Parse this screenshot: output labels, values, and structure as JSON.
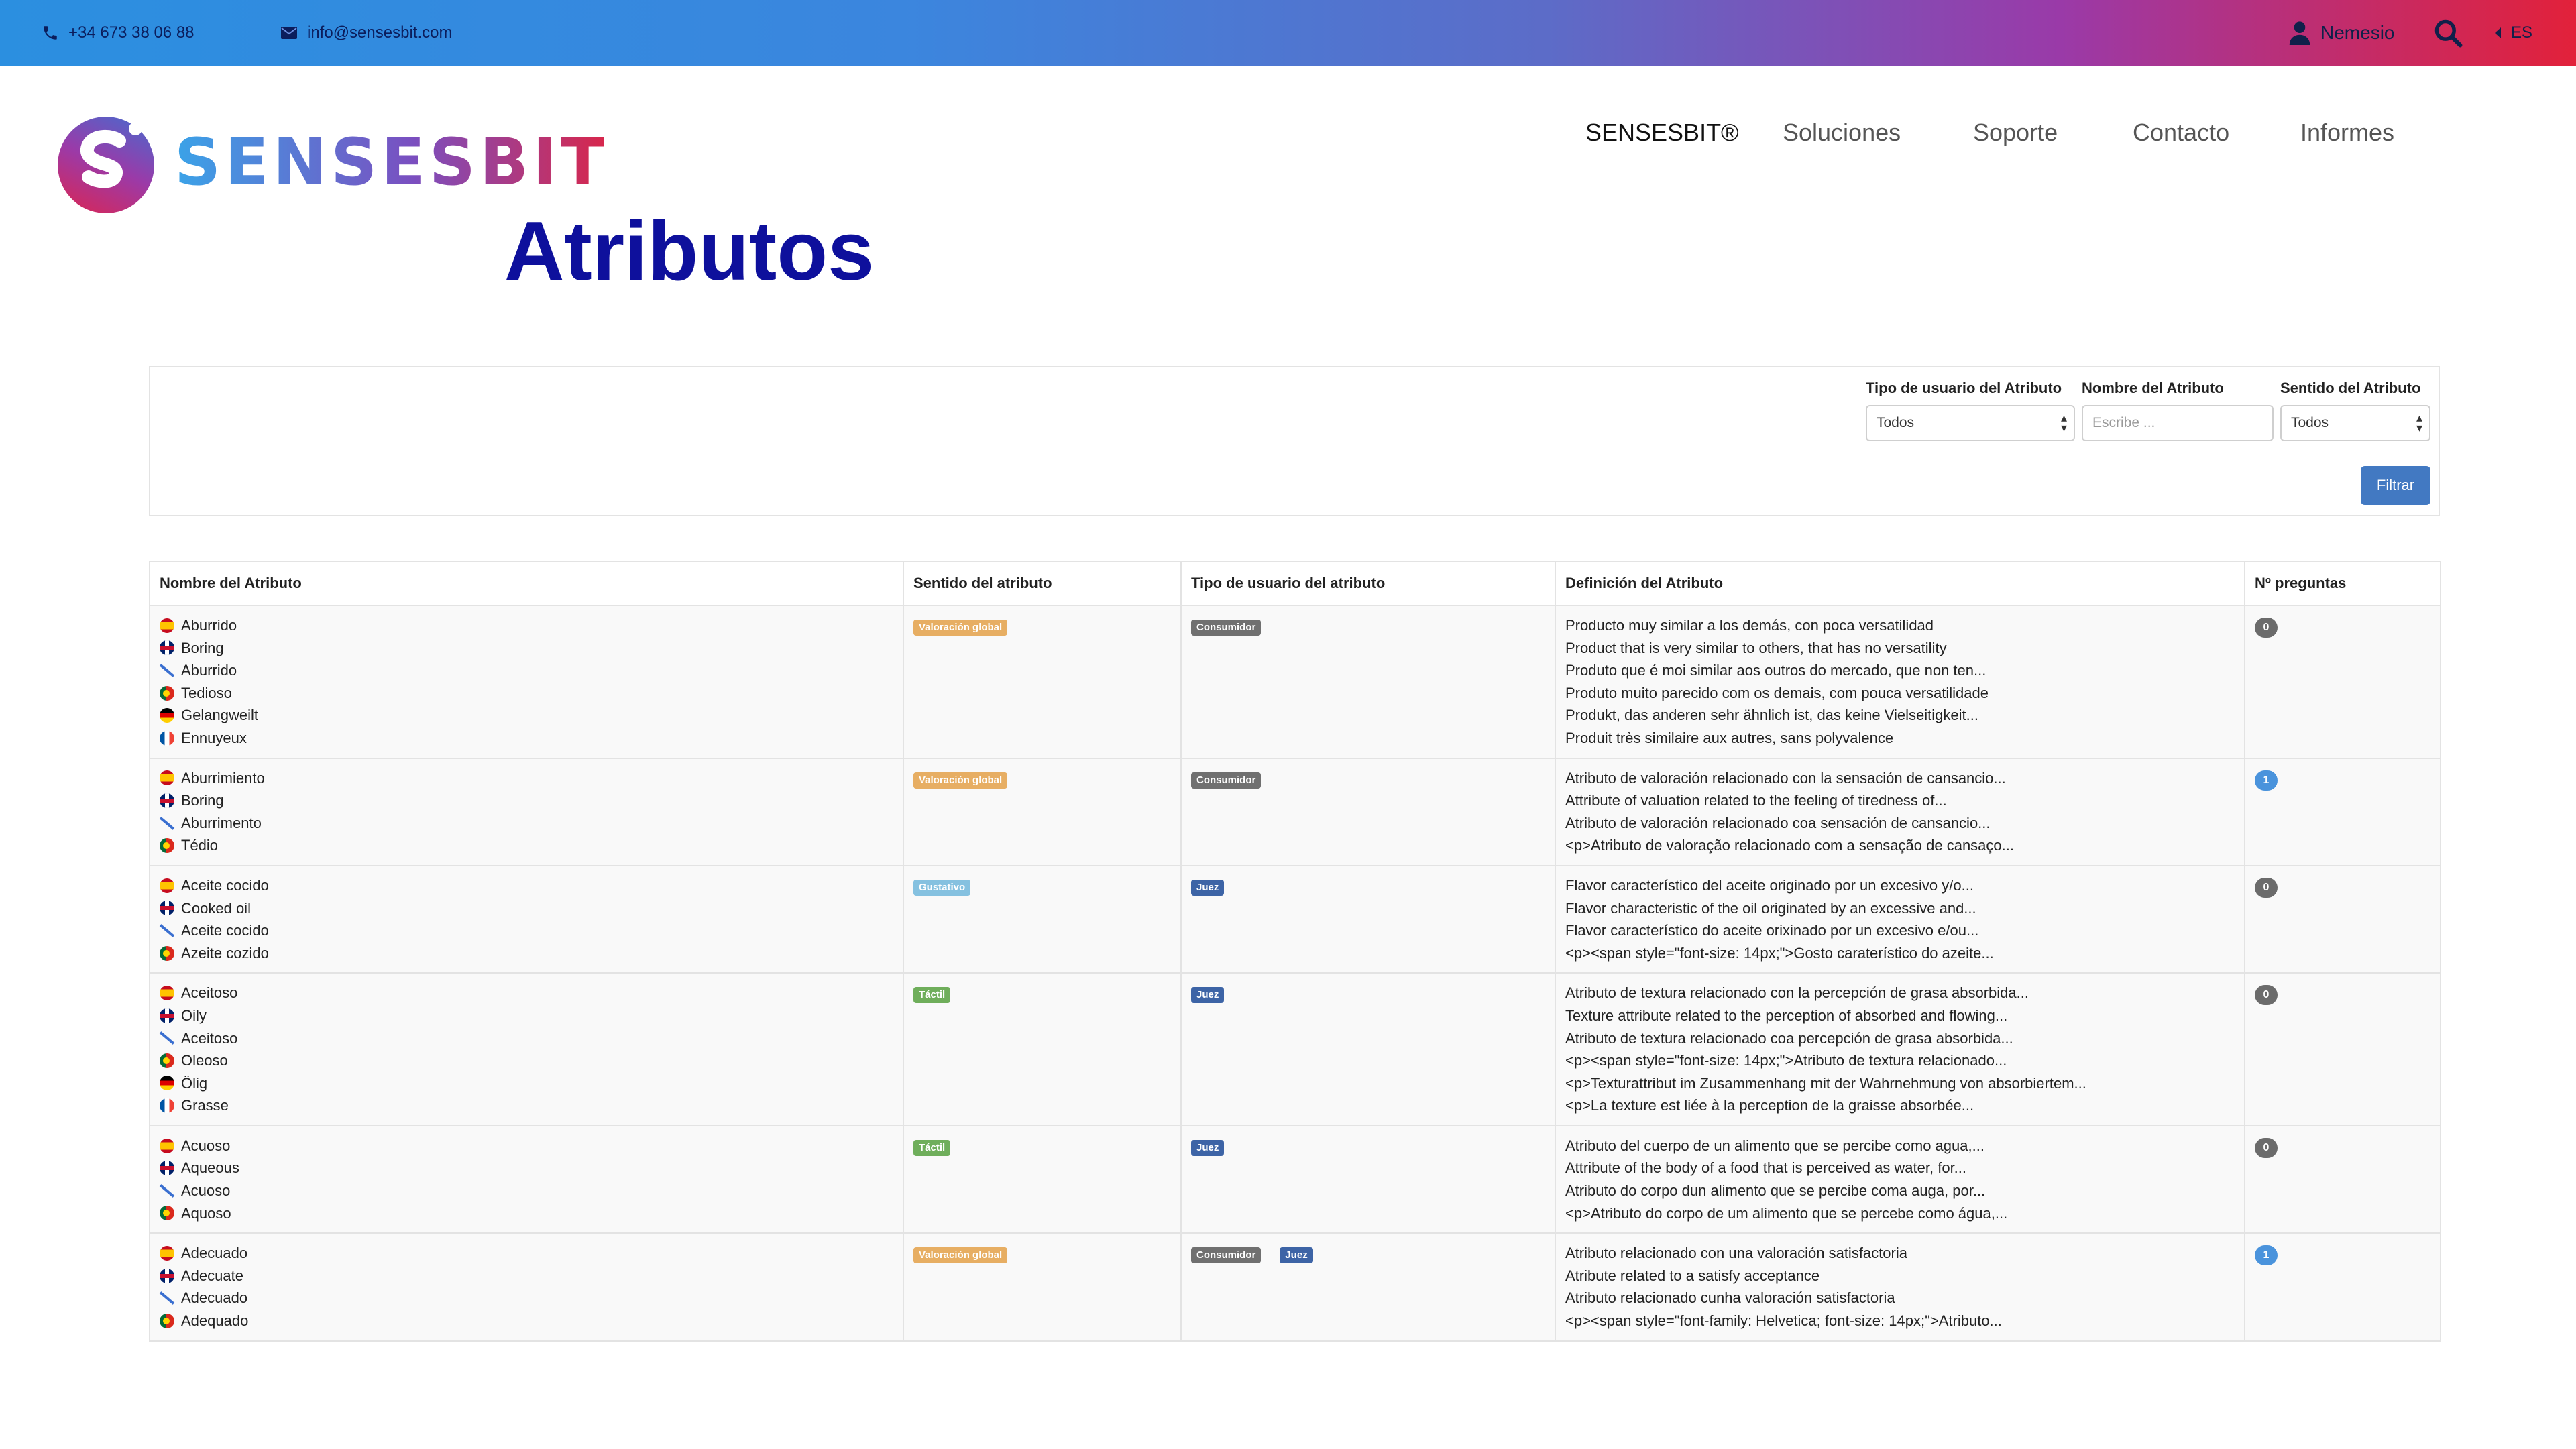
{
  "topbar": {
    "phone": "+34 673 38 06 88",
    "email": "info@sensesbit.com",
    "user": "Nemesio",
    "lang": "ES",
    "icons": [
      "phone-icon",
      "mail-icon",
      "user-icon",
      "search-icon",
      "caret-left-icon"
    ]
  },
  "brand": {
    "name": "SENSESBIT"
  },
  "nav": [
    {
      "label": "SENSESBIT®"
    },
    {
      "label": "Soluciones"
    },
    {
      "label": "Soporte"
    },
    {
      "label": "Contacto"
    },
    {
      "label": "Informes"
    }
  ],
  "page": {
    "title": "Atributos"
  },
  "filters": {
    "user_type_label": "Tipo de usuario del Atributo",
    "user_type_value": "Todos",
    "name_label": "Nombre del Atributo",
    "name_placeholder": "Escribe ...",
    "sense_label": "Sentido del Atributo",
    "sense_value": "Todos",
    "button": "Filtrar"
  },
  "table": {
    "headers": [
      "Nombre del Atributo",
      "Sentido del atributo",
      "Tipo de usuario del atributo",
      "Definición del Atributo",
      "Nº preguntas"
    ],
    "rows": [
      {
        "names": [
          {
            "flag": "es",
            "text": "Aburrido"
          },
          {
            "flag": "gb",
            "text": "Boring"
          },
          {
            "flag": "gl",
            "text": "Aburrido"
          },
          {
            "flag": "pt",
            "text": "Tedioso"
          },
          {
            "flag": "de",
            "text": "Gelangweilt"
          },
          {
            "flag": "fr",
            "text": "Ennuyeux"
          }
        ],
        "sense": {
          "text": "Valoración global",
          "kind": "global"
        },
        "user_types": [
          {
            "text": "Consumidor",
            "kind": "cons"
          }
        ],
        "definitions": [
          "Producto muy similar a los demás, con poca versatilidad",
          "Product that is very similar to others, that has no versatility",
          "Produto que é moi similar aos outros do mercado, que non ten...",
          "Produto muito parecido com os demais, com pouca versatilidade",
          "Produkt, das anderen sehr ähnlich ist, das keine Vielseitigkeit...",
          "Produit très similaire aux autres, sans polyvalence"
        ],
        "questions": "0"
      },
      {
        "names": [
          {
            "flag": "es",
            "text": "Aburrimiento"
          },
          {
            "flag": "gb",
            "text": "Boring"
          },
          {
            "flag": "gl",
            "text": "Aburrimento"
          },
          {
            "flag": "pt",
            "text": "Tédio"
          }
        ],
        "sense": {
          "text": "Valoración global",
          "kind": "global"
        },
        "user_types": [
          {
            "text": "Consumidor",
            "kind": "cons"
          }
        ],
        "definitions": [
          "Atributo de valoración relacionado con la sensación de cansancio...",
          "Attribute of valuation related to the feeling of tiredness of...",
          "Atributo de valoración relacionado coa sensación de cansancio...",
          "<p>Atributo de valoração relacionado com a sensação de cansaço..."
        ],
        "questions": "1"
      },
      {
        "names": [
          {
            "flag": "es",
            "text": "Aceite cocido"
          },
          {
            "flag": "gb",
            "text": "Cooked oil"
          },
          {
            "flag": "gl",
            "text": "Aceite cocido"
          },
          {
            "flag": "pt",
            "text": "Azeite cozido"
          }
        ],
        "sense": {
          "text": "Gustativo",
          "kind": "gust"
        },
        "user_types": [
          {
            "text": "Juez",
            "kind": "juez"
          }
        ],
        "definitions": [
          "Flavor característico del aceite originado por un excesivo y/o...",
          "Flavor characteristic of the oil originated by an excessive and...",
          "Flavor característico do aceite orixinado por un excesivo e/ou...",
          "<p><span style=\"font-size: 14px;\">Gosto caraterístico do azeite..."
        ],
        "questions": "0"
      },
      {
        "names": [
          {
            "flag": "es",
            "text": "Aceitoso"
          },
          {
            "flag": "gb",
            "text": "Oily"
          },
          {
            "flag": "gl",
            "text": "Aceitoso"
          },
          {
            "flag": "pt",
            "text": "Oleoso"
          },
          {
            "flag": "de",
            "text": "Ölig"
          },
          {
            "flag": "fr",
            "text": "Grasse"
          }
        ],
        "sense": {
          "text": "Táctil",
          "kind": "tactil"
        },
        "user_types": [
          {
            "text": "Juez",
            "kind": "juez"
          }
        ],
        "definitions": [
          "Atributo de textura relacionado con la percepción de grasa absorbida...",
          "Texture attribute related to the perception of absorbed and flowing...",
          "Atributo de textura relacionado coa percepción de grasa absorbida...",
          "<p><span style=\"font-size: 14px;\">Atributo de textura relacionado...",
          "<p>Texturattribut im Zusammenhang mit der Wahrnehmung von absorbiertem...",
          "<p>La texture est liée à la perception de la graisse absorbée..."
        ],
        "questions": "0"
      },
      {
        "names": [
          {
            "flag": "es",
            "text": "Acuoso"
          },
          {
            "flag": "gb",
            "text": "Aqueous"
          },
          {
            "flag": "gl",
            "text": "Acuoso"
          },
          {
            "flag": "pt",
            "text": "Aquoso"
          }
        ],
        "sense": {
          "text": "Táctil",
          "kind": "tactil"
        },
        "user_types": [
          {
            "text": "Juez",
            "kind": "juez"
          }
        ],
        "definitions": [
          "Atributo del cuerpo de un alimento que se percibe como agua,...",
          "Attribute of the body of a food that is perceived as water, for...",
          "Atributo do corpo dun alimento que se percibe coma auga, por...",
          "<p>Atributo do corpo de um alimento que se percebe como água,..."
        ],
        "questions": "0"
      },
      {
        "names": [
          {
            "flag": "es",
            "text": "Adecuado"
          },
          {
            "flag": "gb",
            "text": "Adecuate"
          },
          {
            "flag": "gl",
            "text": "Adecuado"
          },
          {
            "flag": "pt",
            "text": "Adequado"
          }
        ],
        "sense": {
          "text": "Valoración global",
          "kind": "global"
        },
        "user_types": [
          {
            "text": "Consumidor",
            "kind": "cons"
          },
          {
            "text": "Juez",
            "kind": "juez"
          }
        ],
        "definitions": [
          "Atributo relacionado con una valoración satisfactoria",
          "Atribute related to a satisfy acceptance",
          "Atributo relacionado cunha valoración satisfactoria",
          "<p><span style=\"font-family: Helvetica; font-size: 14px;\">Atributo..."
        ],
        "questions": "1"
      }
    ]
  }
}
